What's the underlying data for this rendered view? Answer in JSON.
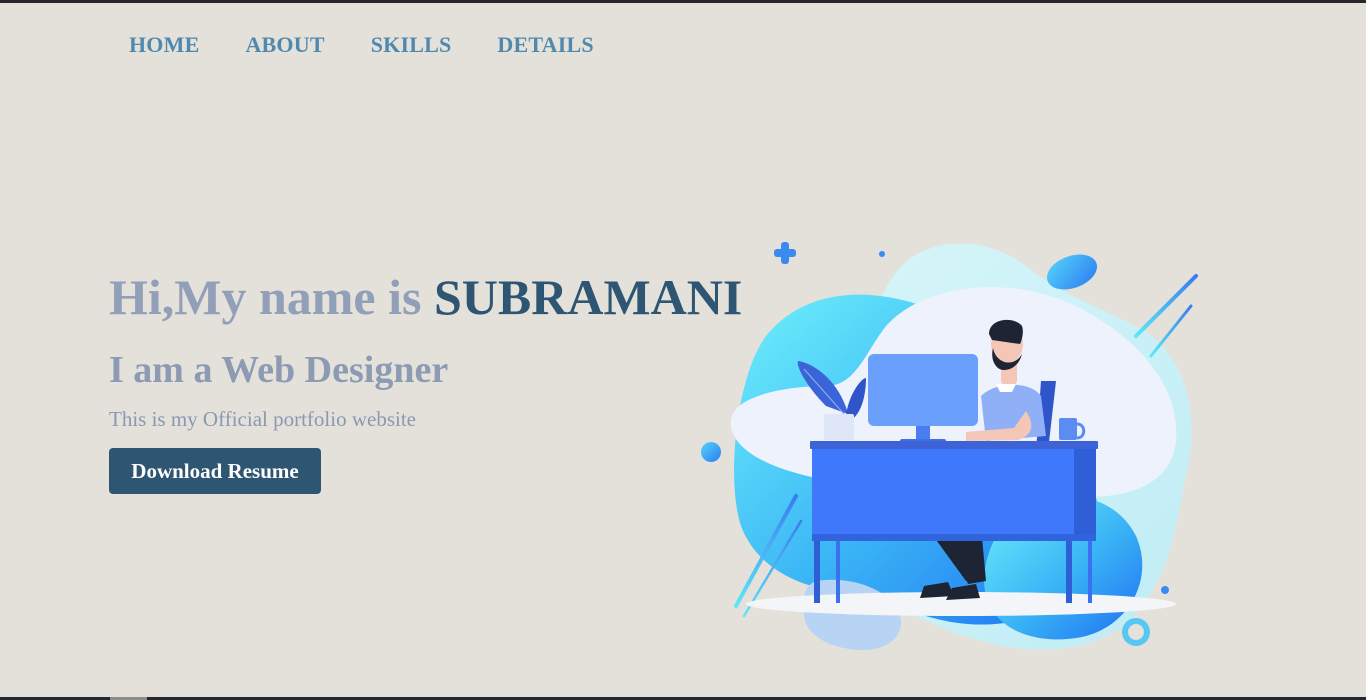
{
  "nav": {
    "items": [
      {
        "label": "HOME"
      },
      {
        "label": "ABOUT"
      },
      {
        "label": "SKILLS"
      },
      {
        "label": "DETAILS"
      }
    ]
  },
  "hero": {
    "greeting": "Hi,My name is ",
    "name": "SUBRAMANI",
    "role": "I am a Web Designer",
    "tagline": "This is my Official portfolio website",
    "cta_label": "Download Resume"
  },
  "illustration": {
    "icon": "person-at-desk-illustration"
  },
  "colors": {
    "background": "#e4e1da",
    "nav_link": "#5089ad",
    "heading_muted": "#929fb9",
    "name_accent": "#2e5673",
    "button_bg": "#2e5673",
    "button_text": "#ffffff"
  }
}
